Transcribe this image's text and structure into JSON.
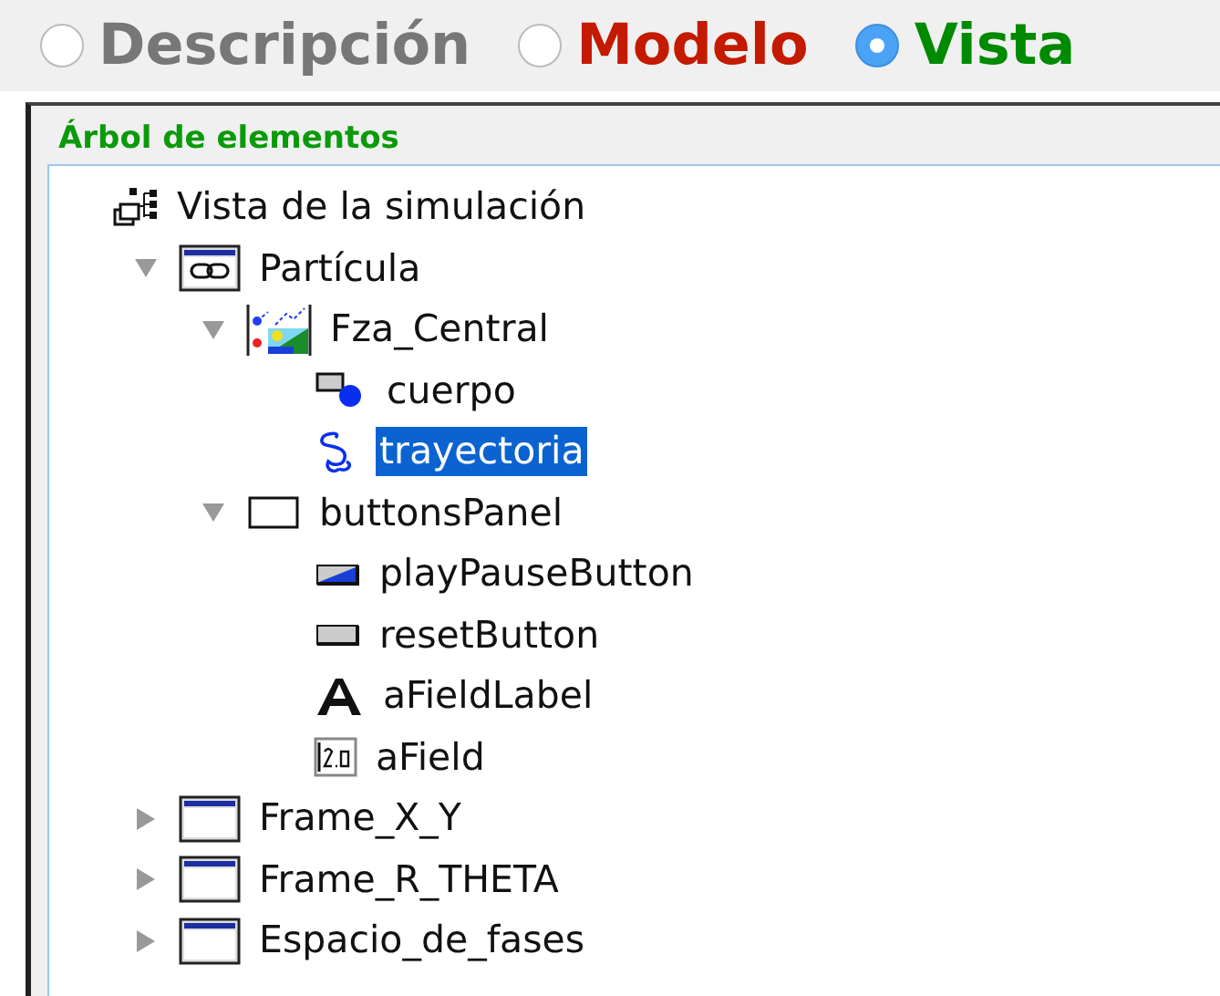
{
  "tabs": [
    {
      "label": "Descripción",
      "selected": false,
      "color": "#777777"
    },
    {
      "label": "Modelo",
      "selected": false,
      "color": "#c41a00"
    },
    {
      "label": "Vista",
      "selected": true,
      "color": "#008a00"
    }
  ],
  "panel": {
    "title": "Árbol de elementos"
  },
  "tree": [
    {
      "label": "Vista de la simulación",
      "kind": "tree",
      "selected": false,
      "children": [
        {
          "label": "Partícula",
          "kind": "frame-link",
          "selected": false,
          "expanded": true,
          "children": [
            {
              "label": "Fza_Central",
              "kind": "drawing-panel",
              "selected": false,
              "expanded": true,
              "children": [
                {
                  "label": "cuerpo",
                  "kind": "shape",
                  "selected": false
                },
                {
                  "label": "trayectoria",
                  "kind": "trail",
                  "selected": true
                }
              ]
            },
            {
              "label": "buttonsPanel",
              "kind": "panel",
              "selected": false,
              "expanded": true,
              "children": [
                {
                  "label": "playPauseButton",
                  "kind": "play-button",
                  "selected": false
                },
                {
                  "label": "resetButton",
                  "kind": "button",
                  "selected": false
                },
                {
                  "label": "aFieldLabel",
                  "kind": "label",
                  "selected": false
                },
                {
                  "label": "aField",
                  "kind": "field",
                  "selected": false
                }
              ]
            }
          ]
        },
        {
          "label": "Frame_X_Y",
          "kind": "frame",
          "selected": false,
          "expanded": false
        },
        {
          "label": "Frame_R_THETA",
          "kind": "frame",
          "selected": false,
          "expanded": false
        },
        {
          "label": "Espacio_de_fases",
          "kind": "frame",
          "selected": false,
          "expanded": false
        }
      ]
    }
  ]
}
